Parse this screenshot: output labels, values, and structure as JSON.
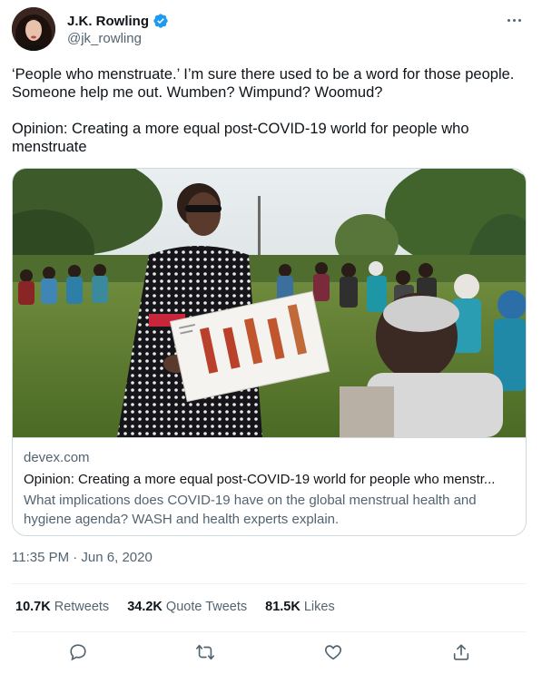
{
  "author": {
    "display_name": "J.K. Rowling",
    "handle": "@jk_rowling",
    "verified_color": "#1d9bf0"
  },
  "tweet": {
    "text_line1": "‘People who menstruate.’ I’m sure there used to be a word for those people. Someone help me out. Wumben? Wimpund? Woomud?",
    "text_line2": "Opinion: Creating a more equal post-COVID-19 world for people who menstruate"
  },
  "card": {
    "domain": "devex.com",
    "title": "Opinion: Creating a more equal post-COVID-19 world for people who menstr...",
    "description": "What implications does COVID-19 have on the global menstrual health and hygiene agenda? WASH and health experts explain."
  },
  "timestamp": "11:35 PM · Jun 6, 2020",
  "stats": {
    "retweets_value": "10.7K",
    "retweets_label": "Retweets",
    "quotes_value": "34.2K",
    "quotes_label": "Quote Tweets",
    "likes_value": "81.5K",
    "likes_label": "Likes"
  },
  "actions": {
    "icons": [
      "reply-icon",
      "retweet-icon",
      "like-icon",
      "share-icon"
    ]
  },
  "colors": {
    "text_primary": "#0f1419",
    "text_secondary": "#536471",
    "border": "#cfd9de"
  }
}
